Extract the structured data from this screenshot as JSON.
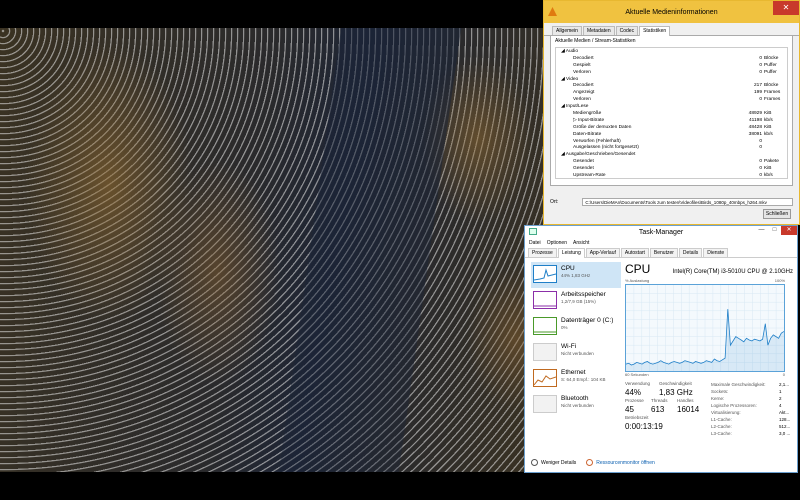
{
  "media_info": {
    "title": "Aktuelle Medieninformationen",
    "tabs": [
      "Allgemein",
      "Metadaten",
      "Codec",
      "Statistiken"
    ],
    "active_tab": 3,
    "subtitle": "Aktuelle Medien / Stream-Statistiken",
    "rows": [
      {
        "label": "◢ Audio",
        "value": "",
        "unit": "",
        "indent": 0
      },
      {
        "label": "Decodiert",
        "value": "0",
        "unit": "Blöcke",
        "indent": 1
      },
      {
        "label": "Gespielt",
        "value": "0",
        "unit": "Puffer",
        "indent": 1
      },
      {
        "label": "Verloren",
        "value": "0",
        "unit": "Puffer",
        "indent": 1
      },
      {
        "label": "◢ Video",
        "value": "",
        "unit": "",
        "indent": 0
      },
      {
        "label": "Decodiert",
        "value": "217",
        "unit": "Blöcke",
        "indent": 1
      },
      {
        "label": "Angezeigt",
        "value": "199",
        "unit": "Frames",
        "indent": 1
      },
      {
        "label": "Verloren",
        "value": "0",
        "unit": "Frames",
        "indent": 1
      },
      {
        "label": "◢ Input/Lese",
        "value": "",
        "unit": "",
        "indent": 0
      },
      {
        "label": "Mediengröße",
        "value": "48929",
        "unit": "KiB",
        "indent": 1
      },
      {
        "label": "▷ Input-Bitrate",
        "value": "41198",
        "unit": "kb/s",
        "indent": 1
      },
      {
        "label": "Größe der demuxten Daten",
        "value": "48428",
        "unit": "KiB",
        "indent": 1
      },
      {
        "label": "Daten-Bitrate",
        "value": "38091",
        "unit": "kb/s",
        "indent": 1
      },
      {
        "label": "Verworfen (Fehlerhaft)",
        "value": "0",
        "unit": "",
        "indent": 1
      },
      {
        "label": "Ausgelassen (nicht fortgesetzt)",
        "value": "0",
        "unit": "",
        "indent": 1
      },
      {
        "label": "◢ Ausgabe/Geschrieben/Gesendet",
        "value": "",
        "unit": "",
        "indent": 0
      },
      {
        "label": "Gesendet",
        "value": "0",
        "unit": "Pakete",
        "indent": 1
      },
      {
        "label": "Gesendet",
        "value": "0",
        "unit": "KiB",
        "indent": 1
      },
      {
        "label": "Upstream-Rate",
        "value": "0",
        "unit": "kb/s",
        "indent": 1
      }
    ],
    "file_label": "Ort:",
    "file_path": "C:\\Users\\DieMAn\\Documents\\Tools zum testen\\Videofiles\\Birds_1080p_40mbps_h264.mkv",
    "close_button": "Schließen"
  },
  "task_manager": {
    "title": "Task-Manager",
    "menu": [
      "Datei",
      "Optionen",
      "Ansicht"
    ],
    "tabs": [
      "Prozesse",
      "Leistung",
      "App-Verlauf",
      "Autostart",
      "Benutzer",
      "Details",
      "Dienste"
    ],
    "active_tab": 1,
    "resources": [
      {
        "name": "CPU",
        "sub": "44% 1,83 GHz",
        "color": "#1f7fc8"
      },
      {
        "name": "Arbeitsspeicher",
        "sub": "1,2/7,9 GB (15%)",
        "color": "#8b2fa8"
      },
      {
        "name": "Datenträger 0 (C:)",
        "sub": "0%",
        "color": "#4a9a2a"
      },
      {
        "name": "Wi-Fi",
        "sub": "Nicht verbunden",
        "color": "#c06a20"
      },
      {
        "name": "Ethernet",
        "sub": "S: 64,0 Empf.: 104 KB",
        "color": "#c06a20"
      },
      {
        "name": "Bluetooth",
        "sub": "Nicht verbunden",
        "color": "#c06a20"
      }
    ],
    "cpu_title": "CPU",
    "cpu_model": "Intel(R) Core(TM) i3-5010U CPU @ 2.10GHz",
    "graph_label": "% Auslastung",
    "graph_max": "100%",
    "graph_time": "60 Sekunden",
    "graph_min": "0",
    "graph_values": [
      8,
      9,
      7,
      8,
      10,
      9,
      8,
      10,
      11,
      9,
      8,
      9,
      10,
      12,
      10,
      9,
      8,
      10,
      11,
      10,
      9,
      10,
      12,
      11,
      10,
      9,
      11,
      10,
      9,
      10,
      12,
      11,
      10,
      14,
      12,
      11,
      13,
      15,
      72,
      30,
      35,
      40,
      38,
      36,
      34,
      38,
      36,
      35,
      37,
      36,
      35,
      37,
      55,
      30,
      38,
      42,
      40,
      38,
      44,
      46
    ],
    "stats": {
      "util_label": "Verwendung",
      "util": "44%",
      "speed_label": "Geschwindigkeit",
      "speed": "1,83 GHz",
      "proc_label": "Prozesse",
      "proc": "45",
      "threads_label": "Threads",
      "threads": "613",
      "handles_label": "Handles",
      "handles": "16014",
      "uptime_label": "Betriebszeit",
      "uptime": "0:00:13:19"
    },
    "specs": [
      {
        "label": "Maximale Geschwindigkeit:",
        "value": "2,1..."
      },
      {
        "label": "Sockets:",
        "value": "1"
      },
      {
        "label": "Kerne:",
        "value": "2"
      },
      {
        "label": "Logische Prozessoren:",
        "value": "4"
      },
      {
        "label": "Virtualisierung:",
        "value": "Akt..."
      },
      {
        "label": "L1-Cache:",
        "value": "128..."
      },
      {
        "label": "L2-Cache:",
        "value": "512..."
      },
      {
        "label": "L3-Cache:",
        "value": "3,0 ..."
      }
    ],
    "fewer_details": "Weniger Details",
    "resource_monitor": "Ressourcenmonitor öffnen"
  }
}
